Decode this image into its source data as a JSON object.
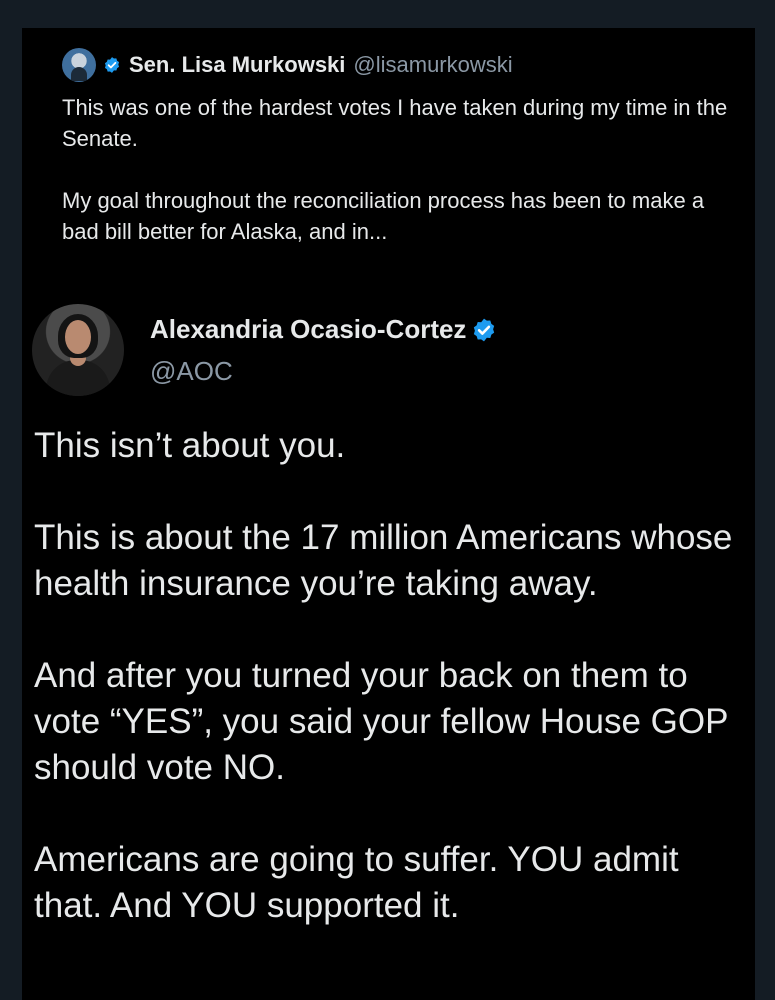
{
  "quoted_tweet": {
    "author_name": "Sen. Lisa Murkowski",
    "author_handle": "@lisamurkowski",
    "paragraphs": [
      "This was one of the hardest votes I have taken during my time in the Senate.",
      "My goal throughout the reconciliation process has been to make a bad bill better for Alaska, and in..."
    ]
  },
  "tweet": {
    "author_name": "Alexandria Ocasio-Cortez",
    "author_handle": "@AOC",
    "paragraphs": [
      "This isn’t about you.",
      "This is about the 17 million Americans whose health insurance you’re taking away.",
      "And after you turned your back on them to vote “YES”, you said your fellow House GOP should vote NO.",
      "Americans are going to suffer. YOU admit that. And YOU supported it."
    ]
  },
  "icons": {
    "verified_badge": "verified-badge-icon"
  },
  "colors": {
    "background": "#000000",
    "page_background": "#141c24",
    "text": "#e7e9ea",
    "secondary_text": "#8b98a5",
    "verified_blue": "#1d9bf0"
  }
}
